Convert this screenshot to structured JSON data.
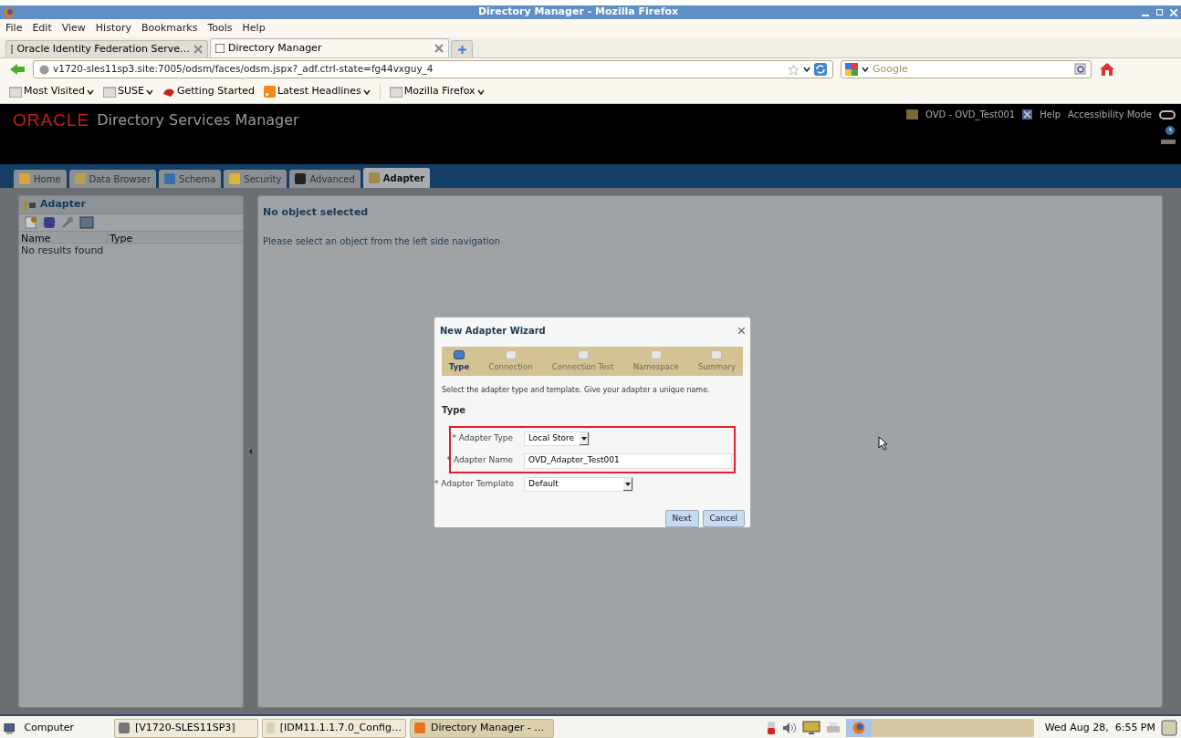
{
  "window": {
    "title": "Directory Manager - Mozilla Firefox"
  },
  "menu": [
    "File",
    "Edit",
    "View",
    "History",
    "Bookmarks",
    "Tools",
    "Help"
  ],
  "browser_tabs": [
    {
      "label": "Oracle Identity Federation Serve…",
      "selected": false
    },
    {
      "label": "Directory Manager",
      "selected": true
    }
  ],
  "address_bar": {
    "url": "v1720-sles11sp3.site:7005/odsm/faces/odsm.jspx?_adf.ctrl-state=fg44vxguy_4"
  },
  "search": {
    "placeholder": "Google"
  },
  "bookmarks": [
    {
      "label": "Most Visited",
      "kind": "menu"
    },
    {
      "label": "SUSE",
      "kind": "menu"
    },
    {
      "label": "Getting Started",
      "kind": "link"
    },
    {
      "label": "Latest Headlines",
      "kind": "feed"
    },
    {
      "label": "Mozilla Firefox",
      "kind": "menu"
    }
  ],
  "app_header": {
    "logo": "ORACLE",
    "title": "Directory Services Manager",
    "connection": "OVD - OVD_Test001",
    "links": [
      "Help",
      "Accessibility Mode"
    ]
  },
  "app_tabs": [
    {
      "label": "Home",
      "selected": false
    },
    {
      "label": "Data Browser",
      "selected": false
    },
    {
      "label": "Schema",
      "selected": false
    },
    {
      "label": "Security",
      "selected": false
    },
    {
      "label": "Advanced",
      "selected": false
    },
    {
      "label": "Adapter",
      "selected": true
    }
  ],
  "left_panel": {
    "title": "Adapter",
    "columns": [
      "Name",
      "Type"
    ],
    "empty_text": "No results found"
  },
  "right_panel": {
    "title": "No object selected",
    "message": "Please select an object from the left side navigation"
  },
  "dialog": {
    "title": "New Adapter Wizard",
    "steps": [
      {
        "label": "Type",
        "selected": true
      },
      {
        "label": "Connection",
        "selected": false
      },
      {
        "label": "Connection Test",
        "selected": false
      },
      {
        "label": "Namespace",
        "selected": false
      },
      {
        "label": "Summary",
        "selected": false
      }
    ],
    "instructions": "Select the adapter type and template. Give your adapter a unique name.",
    "section": "Type",
    "fields": [
      {
        "label": "* Adapter Type",
        "kind": "select",
        "value": "Local Store",
        "highlighted": true
      },
      {
        "label": "* Adapter Name",
        "kind": "text",
        "value": "OVD_Adapter_Test001",
        "highlighted": true
      },
      {
        "label": "* Adapter Template",
        "kind": "select",
        "value": "Default",
        "highlighted": false
      }
    ],
    "buttons": [
      "Next",
      "Cancel"
    ]
  },
  "taskbar": {
    "start": "Computer",
    "tasks": [
      {
        "label": "[V1720-SLES11SP3]",
        "selected": false
      },
      {
        "label": "[IDM11.1.1.7.0_Config…",
        "selected": false
      },
      {
        "label": "Directory Manager - …",
        "selected": true
      }
    ],
    "clock": "Wed Aug 28,  6:55 PM"
  }
}
